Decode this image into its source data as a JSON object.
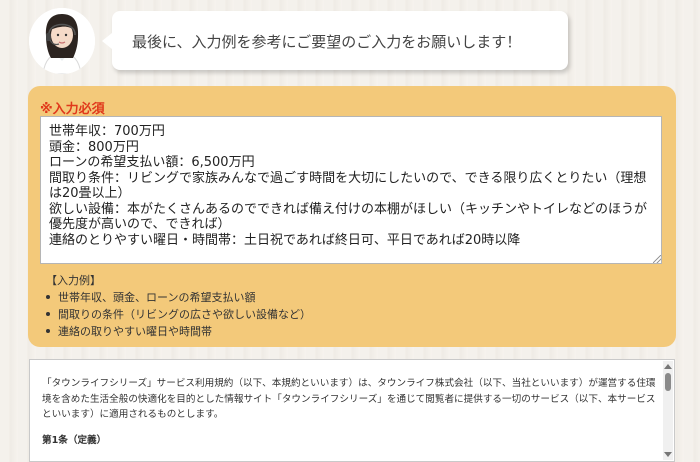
{
  "header": {
    "message": "最後に、入力例を参考にご要望のご入力をお願いします！"
  },
  "form": {
    "required_label": "※入力必須",
    "textarea_value": "世帯年収：700万円\n頭金：800万円\nローンの希望支払い額：6,500万円\n間取り条件：リビングで家族みんなで過ごす時間を大切にしたいので、できる限り広くとりたい（理想は20畳以上）\n欲しい設備：本がたくさんあるのでできれば備え付けの本棚がほしい（キッチンやトイレなどのほうが優先度が高いので、できれば）\n連絡のとりやすい曜日・時間帯：土日祝であれば終日可、平日であれば20時以降",
    "example_title": "【入力例】",
    "examples": [
      "世帯年収、頭金、ローンの希望支払い額",
      "間取りの条件（リビングの広さや欲しい設備など）",
      "連絡の取りやすい曜日や時間帯"
    ]
  },
  "terms": {
    "body": "「タウンライフシリーズ」サービス利用規約（以下、本規約といいます）は、タウンライフ株式会社（以下、当社といいます）が運営する住環境を含めた生活全般の快適化を目的とした情報サイト「タウンライフシリーズ」を通じて閲覧者に提供する一切のサービス（以下、本サービスといいます）に適用されるものとします。",
    "heading": "第1条（定義）"
  },
  "colors": {
    "panel": "#f3c97a",
    "required": "#e0381b"
  },
  "icons": {
    "avatar": "operator-avatar-icon"
  }
}
